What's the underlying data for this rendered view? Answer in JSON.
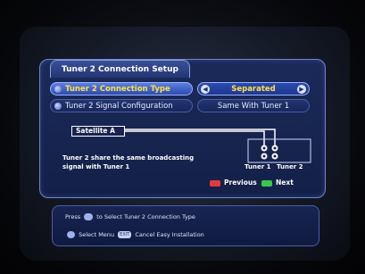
{
  "title": "Tuner 2 Connection Setup",
  "menu": [
    {
      "label": "Tuner 2 Connection Type",
      "value": "Separated",
      "selected": true
    },
    {
      "label": "Tuner 2 Signal Configuration",
      "value": "Same With Tuner 1",
      "selected": false
    }
  ],
  "diagram": {
    "satellite_label": "Satellite A",
    "description": "Tuner 2 share the same broadcasting signal with Tuner 1",
    "tuner1_label": "Tuner 1",
    "tuner2_label": "Tuner 2"
  },
  "nav": {
    "previous_label": "Previous",
    "next_label": "Next",
    "previous_color": "#e23a3a",
    "next_color": "#39c84a"
  },
  "help": {
    "press_text": "Press",
    "select_text": "to Select Tuner 2 Connection Type",
    "menu_text": "Select Menu",
    "exit_key": "EXIT",
    "cancel_text": "Cancel Easy Installation"
  },
  "colors": {
    "highlight_text": "#ffe24a",
    "panel_border": "#6f86c7"
  }
}
